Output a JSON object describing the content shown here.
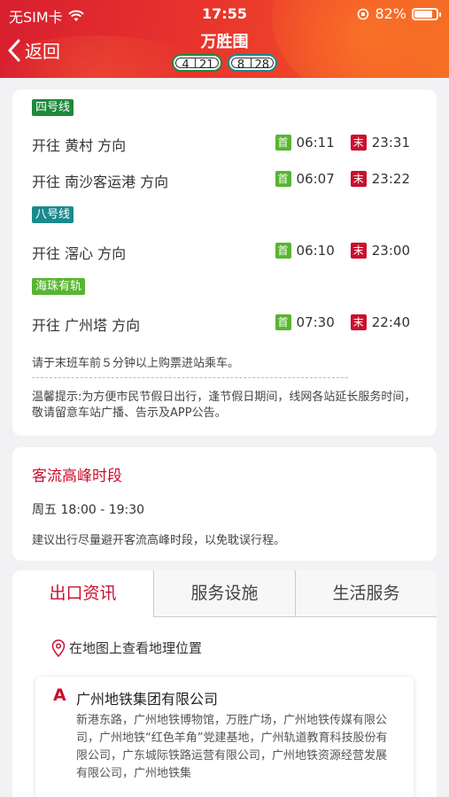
{
  "status_bar": {
    "carrier": "无SIM卡",
    "time": "17:55",
    "battery": "82%",
    "battery_level": 0.82
  },
  "header": {
    "back_label": "返回",
    "title": "万胜围",
    "lines": [
      {
        "a": "4",
        "b": "21",
        "color": "#1f8a3a"
      },
      {
        "a": "8",
        "b": "28",
        "color": "#1a8a8f"
      }
    ]
  },
  "schedule": {
    "first_label": "首",
    "last_label": "末",
    "groups": [
      {
        "line": "四号线",
        "color": "#1f8a3a",
        "rows": [
          {
            "direction": "开往 黄村 方向",
            "first": "06:11",
            "last": "23:31"
          },
          {
            "direction": "开往 南沙客运港 方向",
            "first": "06:07",
            "last": "23:22"
          }
        ]
      },
      {
        "line": "八号线",
        "color": "#1a8a8f",
        "rows": [
          {
            "direction": "开往 滘心 方向",
            "first": "06:10",
            "last": "23:00"
          }
        ]
      },
      {
        "line": "海珠有轨",
        "color": "#58b531",
        "rows": [
          {
            "direction": "开往 广州塔 方向",
            "first": "07:30",
            "last": "22:40"
          }
        ]
      }
    ],
    "note": "请于末班车前５分钟以上购票进站乘车。",
    "tip": "温馨提示:为方便市民节假日出行，逢节假日期间，线网各站延长服务时间，敬请留意车站广播、告示及APP公告。"
  },
  "peak": {
    "title": "客流高峰时段",
    "time": "周五  18:00 - 19:30",
    "note": "建议出行尽量避开客流高峰时段，以免耽误行程。"
  },
  "exits": {
    "tabs": [
      "出口资讯",
      "服务设施",
      "生活服务"
    ],
    "active_tab": 0,
    "map_link": "在地图上查看地理位置",
    "items": [
      {
        "letter": "A",
        "name": "广州地铁集团有限公司",
        "desc": "新港东路，广州地铁博物馆，万胜广场，广州地铁传媒有限公司，广州地铁“红色羊角”党建基地，广州轨道教育科技股份有限公司，广东城际铁路运营有限公司，广州地铁资源经营发展有限公司，广州地铁集"
      }
    ]
  },
  "colors": {
    "accent": "#c8102e",
    "first_badge": "#58b531",
    "last_badge": "#c8102e"
  }
}
